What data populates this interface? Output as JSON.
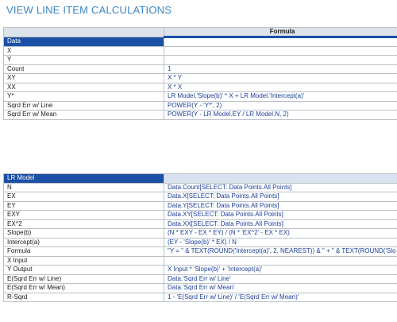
{
  "page": {
    "title": "VIEW LINE ITEM CALCULATIONS"
  },
  "data_table": {
    "formula_header": "Formula",
    "section_label": "Data",
    "rows": [
      {
        "name": "X",
        "formula": ""
      },
      {
        "name": "Y",
        "formula": ""
      },
      {
        "name": "Count",
        "formula": "1"
      },
      {
        "name": "XY",
        "formula": "X * Y"
      },
      {
        "name": "XX",
        "formula": "X * X"
      },
      {
        "name": "Y*",
        "formula": "LR Model.'Slope(b)' * X + LR Model.'Intercept(a)'"
      },
      {
        "name": "Sqrd Err w/ Line",
        "formula": "POWER(Y - 'Y*', 2)"
      },
      {
        "name": "Sqrd Err w/ Mean",
        "formula": "POWER(Y - LR Model.EY / LR Model.N, 2)"
      }
    ]
  },
  "lr_table": {
    "section_label": "LR Model",
    "rows": [
      {
        "name": "N",
        "formula": "Data.Count[SELECT: Data Points.All Points]"
      },
      {
        "name": "EX",
        "formula": "Data.X[SELECT: Data Points.All Points]"
      },
      {
        "name": "EY",
        "formula": "Data.Y[SELECT: Data Points.All Points]"
      },
      {
        "name": "EXY",
        "formula": "Data.XY[SELECT: Data Points.All Points]"
      },
      {
        "name": "EX^2",
        "formula": "Data.XX[SELECT: Data Points.All Points]"
      },
      {
        "name": "Slope(b)",
        "formula": "(N * EXY - EX * EY) / (N * 'EX^2' - EX * EX)"
      },
      {
        "name": "Intercept(a)",
        "formula": "(EY - 'Slope(b)' * EX) / N"
      },
      {
        "name": "Formula",
        "formula": "\"Y = \" & TEXT(ROUND('Intercept(a)', 2, NEAREST)) & \" + \" & TEXT(ROUND('Slo"
      },
      {
        "name": "X Input",
        "formula": ""
      },
      {
        "name": "Y Output",
        "formula": "X Input * 'Slope(b)' + 'Intercept(a)'"
      },
      {
        "name": "E(Sqrd Err w/ Line)",
        "formula": "Data.'Sqrd Err w/ Line'"
      },
      {
        "name": "E(Sqrd Err w/ Mean)",
        "formula": "Data.'Sqrd Err w/ Mean'"
      },
      {
        "name": "R-Sqrd",
        "formula": "1 - 'E(Sqrd Err w/ Line)' / 'E(Sqrd Err w/ Mean)'"
      }
    ]
  }
}
